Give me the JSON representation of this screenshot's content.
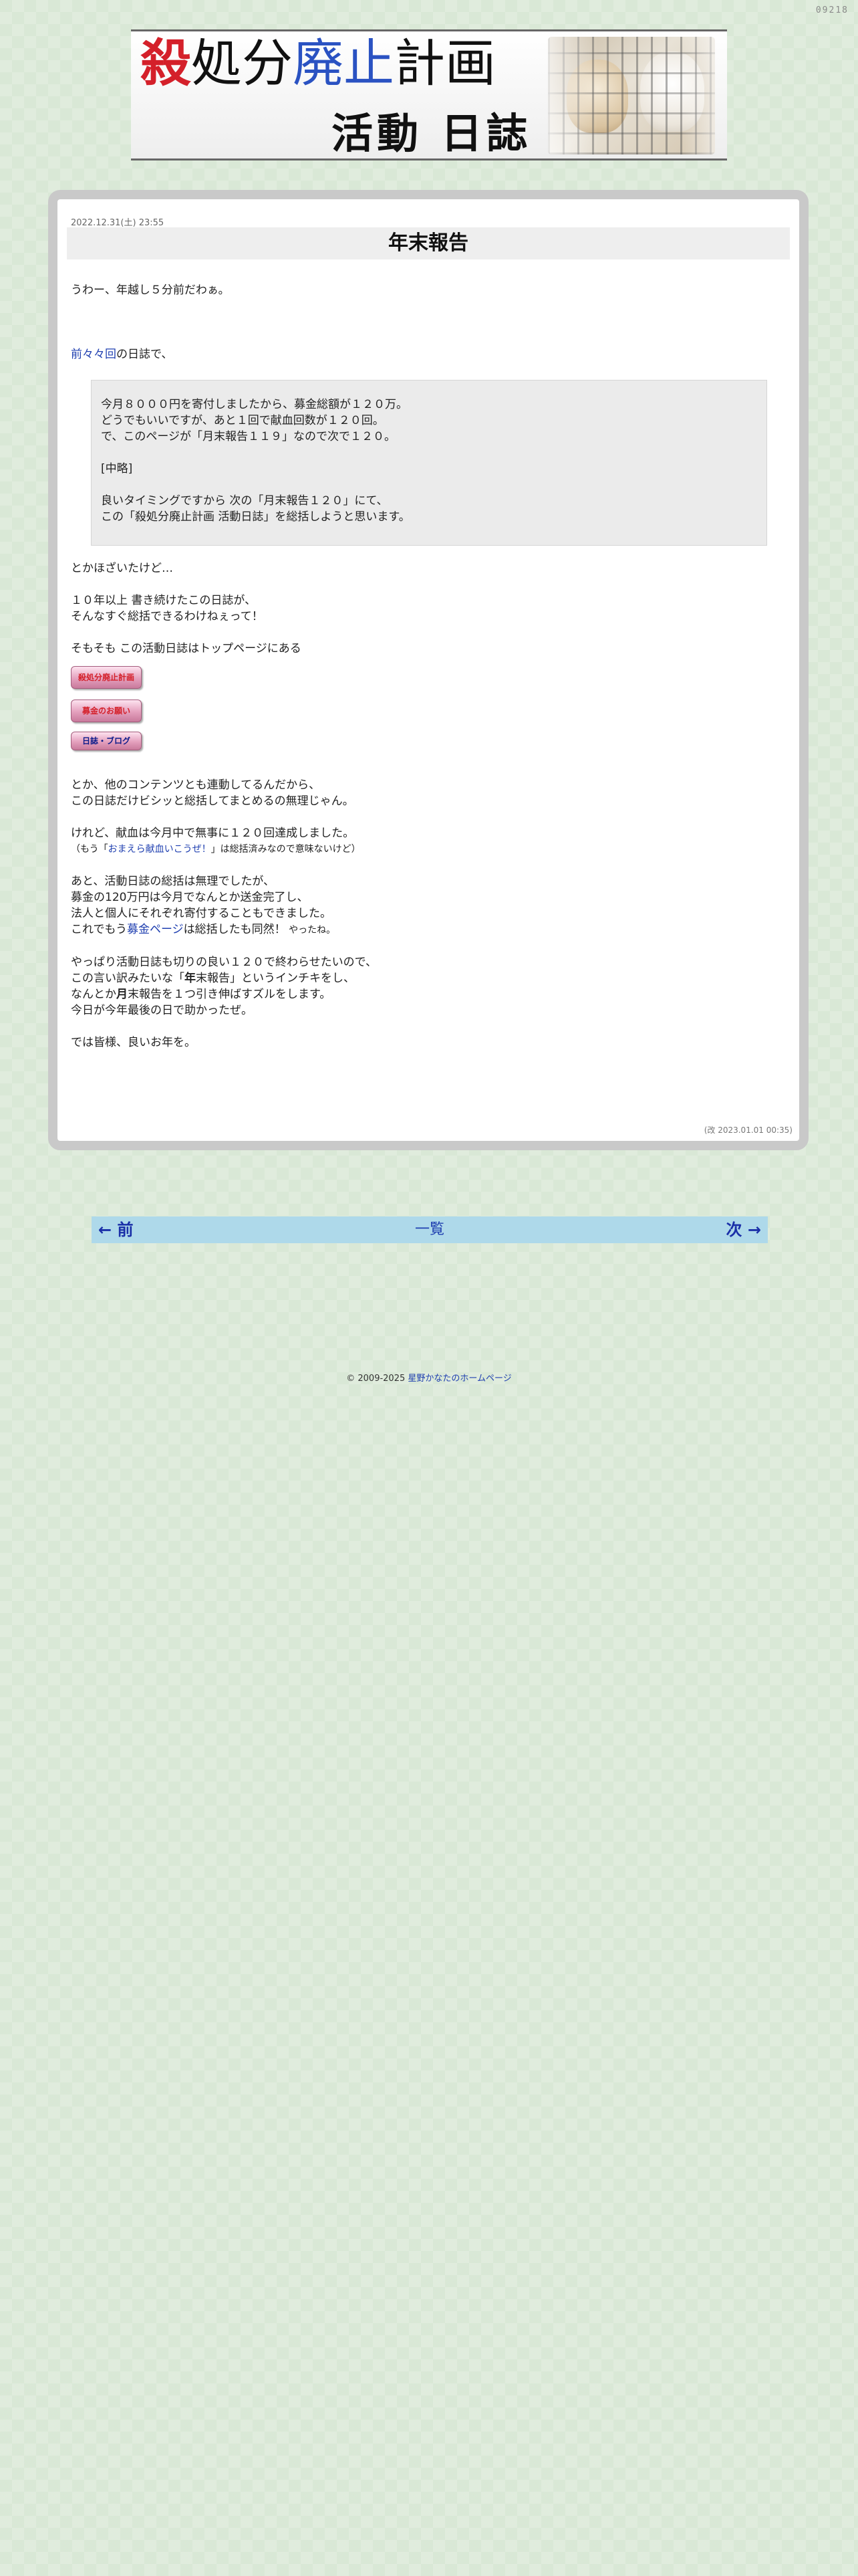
{
  "counter": "09218",
  "banner": {
    "title_part1": "殺",
    "title_part2": "処分",
    "title_part3": "廃止",
    "title_part4": "計画",
    "subtitle": "活動 日誌",
    "photo_alt": "dogs-in-cage-photo"
  },
  "post": {
    "date": "2022.12.31(土) 23:55",
    "title": "年末報告",
    "line1": "うわー、年越し５分前だわぁ。",
    "link_prev": "前々々回",
    "link_prev_suffix": "の日誌で、",
    "quote": {
      "l1": "今月８０００円を寄付しましたから、募金総額が１２０万。",
      "l2": "どうでもいいですが、あと１回で献血回数が１２０回。",
      "l3": "で、このページが「月末報告１１９」なので次で１２０。",
      "l4": "[中略]",
      "l5": "良いタイミングですから 次の「月末報告１２０」にて、",
      "l6": "この「殺処分廃止計画 活動日誌」を総括しようと思います。"
    },
    "p2": "とかほざいたけど…",
    "p3a": "１０年以上 書き続けたこの日誌が、",
    "p3b": "そんなすぐ総括できるわけねぇって！",
    "p4": "そもそも この活動日誌はトップページにある",
    "buttons": {
      "b1": "殺処分廃止計画",
      "b2": "募金のお願い",
      "b3": "日誌・ブログ"
    },
    "p5a": "とか、他のコンテンツとも連動してるんだから、",
    "p5b": "この日誌だけビシッと総括してまとめるの無理じゃん。",
    "p6a": "けれど、献血は今月中で無事に１２０回達成しました。",
    "p6b_pre": "（もう「",
    "p6b_link": "おまえら献血いこうぜ！",
    "p6b_post": "」は総括済みなので意味ないけど）",
    "p7a": "あと、活動日誌の総括は無理でしたが、",
    "p7b": "募金の120万円は今月でなんとか送金完了し、",
    "p7c": "法人と個人にそれぞれ寄付することもできました。",
    "p7d_pre": "これでもう",
    "p7d_link": "募金ページ",
    "p7d_mid": "は総括したも同然！",
    "p7d_small": " やったね。",
    "p8a": "やっぱり活動日誌も切りの良い１２０で終わらせたいので、",
    "p8b_pre": "この言い訳みたいな「",
    "p8b_bold": "年",
    "p8b_post": "末報告」というインチキをし、",
    "p8c_pre": "なんとか",
    "p8c_bold": "月",
    "p8c_post": "末報告を１つ引き伸ばすズルをします。",
    "p8d": "今日が今年最後の日で助かったぜ。",
    "p9": "では皆様、良いお年を。",
    "edited": "(改 2023.01.01 00:35)"
  },
  "pager": {
    "prev": "← 前",
    "list": "一覧",
    "next": "次 →"
  },
  "footer": {
    "copyright": "© 2009-2025 ",
    "link": "星野かなたのホームページ"
  }
}
